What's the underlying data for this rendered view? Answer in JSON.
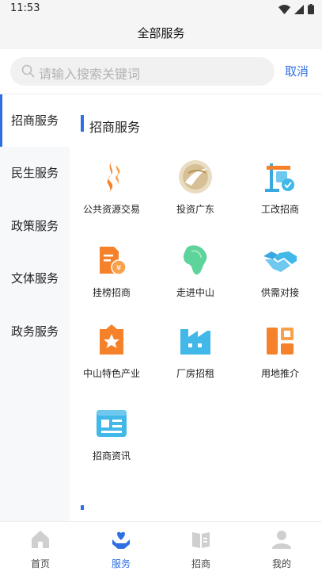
{
  "status_bar": {
    "time": "11:53"
  },
  "header": {
    "title": "全部服务"
  },
  "search": {
    "placeholder": "请输入搜索关键词",
    "cancel_label": "取消"
  },
  "sidebar": {
    "items": [
      {
        "label": "招商服务",
        "active": true
      },
      {
        "label": "民生服务",
        "active": false
      },
      {
        "label": "政策服务",
        "active": false
      },
      {
        "label": "文体服务",
        "active": false
      },
      {
        "label": "政务服务",
        "active": false
      }
    ]
  },
  "main": {
    "section_title": "招商服务",
    "services": [
      {
        "label": "公共资源交易",
        "icon": "public-resource-trade-icon"
      },
      {
        "label": "投资广东",
        "icon": "invest-guangdong-icon"
      },
      {
        "label": "工改招商",
        "icon": "engineering-reform-icon"
      },
      {
        "label": "挂榜招商",
        "icon": "listing-investment-icon"
      },
      {
        "label": "走进中山",
        "icon": "zhongshan-map-icon"
      },
      {
        "label": "供需对接",
        "icon": "handshake-icon"
      },
      {
        "label": "中山特色产业",
        "icon": "featured-industry-icon"
      },
      {
        "label": "厂房招租",
        "icon": "factory-icon"
      },
      {
        "label": "用地推介",
        "icon": "land-promotion-icon"
      },
      {
        "label": "招商资讯",
        "icon": "investment-news-icon"
      }
    ]
  },
  "tabbar": {
    "items": [
      {
        "label": "首页",
        "icon": "home-icon",
        "active": false
      },
      {
        "label": "服务",
        "icon": "service-heart-icon",
        "active": true
      },
      {
        "label": "招商",
        "icon": "investment-book-icon",
        "active": false
      },
      {
        "label": "我的",
        "icon": "user-icon",
        "active": false
      }
    ]
  },
  "colors": {
    "accent": "#2f6fe4",
    "orange": "#f5822a",
    "cyan": "#41b8e8",
    "gold": "#c8a96e",
    "green": "#5ed39a"
  }
}
